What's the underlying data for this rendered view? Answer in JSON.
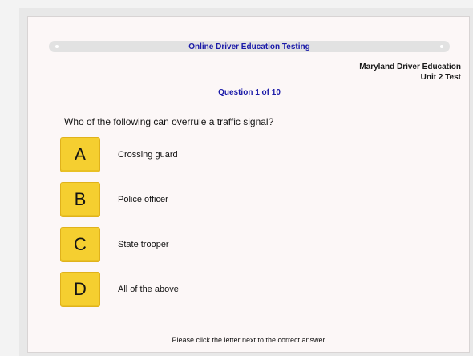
{
  "header": {
    "title": "Online Driver Education Testing",
    "course_line1": "Maryland Driver Education",
    "course_line2": "Unit 2 Test"
  },
  "question": {
    "counter": "Question 1 of 10",
    "text": "Who of the following can overrule a traffic signal?"
  },
  "answers": [
    {
      "letter": "A",
      "text": "Crossing guard"
    },
    {
      "letter": "B",
      "text": "Police officer"
    },
    {
      "letter": "C",
      "text": "State trooper"
    },
    {
      "letter": "D",
      "text": "All of the above"
    }
  ],
  "footer": {
    "instructions": "Please click the letter next to the correct answer."
  },
  "colors": {
    "accent_text": "#1a1aa8",
    "button_fill": "#f5cf30",
    "panel_bg": "#fcf7f7"
  }
}
